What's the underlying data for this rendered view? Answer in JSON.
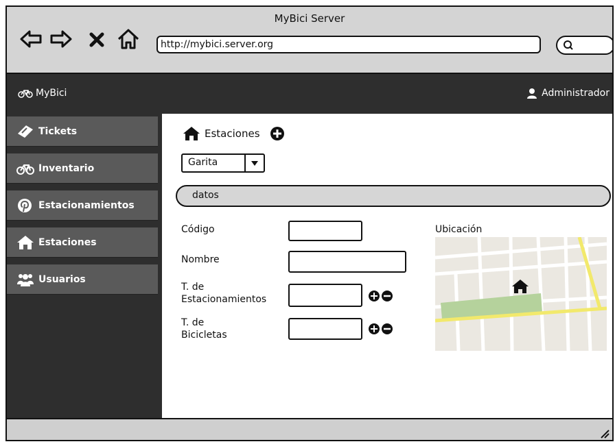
{
  "browser": {
    "window_title": "MyBici Server",
    "url": "http://mybici.server.org",
    "nav_icons": [
      "back-arrow-icon",
      "forward-arrow-icon",
      "stop-icon",
      "home-icon"
    ]
  },
  "header": {
    "brand": "MyBici",
    "user": "Administrador",
    "bg_color": "#2e2e2e"
  },
  "sidebar": {
    "items": [
      {
        "label": "Tickets",
        "icon": "ticket-icon"
      },
      {
        "label": "Inventario",
        "icon": "bicycle-icon"
      },
      {
        "label": "Estacionamientos",
        "icon": "pinterest-icon"
      },
      {
        "label": "Estaciones",
        "icon": "home-icon"
      },
      {
        "label": "Usuarios",
        "icon": "users-icon"
      }
    ],
    "item_color": "#5a5a5a"
  },
  "main": {
    "breadcrumb": "Estaciones",
    "select": {
      "value": "Garita"
    },
    "section": "datos",
    "form": {
      "codigo_label": "Código",
      "nombre_label": "Nombre",
      "t_estacionamientos_label_1": "T. de",
      "t_estacionamientos_label_2": "Estacionamientos",
      "t_bicicletas_label_1": "T. de",
      "t_bicicletas_label_2": "Bicicletas",
      "codigo_value": "",
      "nombre_value": "",
      "t_estacionamientos_value": "",
      "t_bicicletas_value": ""
    },
    "map_label": "Ubicación"
  }
}
